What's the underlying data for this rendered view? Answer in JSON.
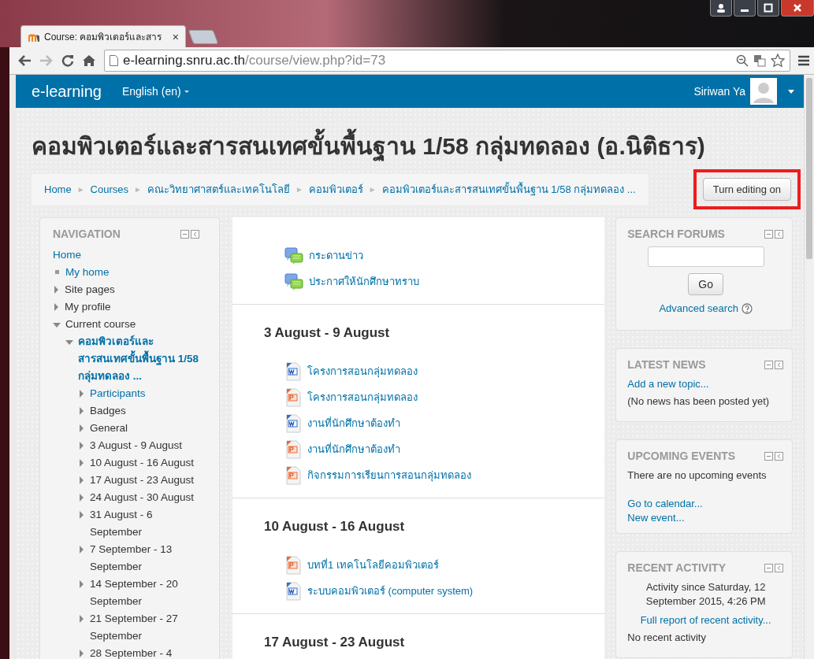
{
  "browser": {
    "tab": {
      "title": "Course: คอมพิวเตอร์และสาร",
      "close": "×"
    },
    "url": {
      "host": "e-learning.snru.ac.th",
      "path": "/course/view.php?id=73"
    }
  },
  "navbar": {
    "brand": "e-learning",
    "language": "English (en)",
    "user": "Siriwan Ya"
  },
  "page": {
    "title": "คอมพิวเตอร์และสารสนเทศขั้นพื้นฐาน 1/58 กลุ่มทดลอง (อ.นิติธาร)",
    "breadcrumb_separator": "►",
    "breadcrumb": [
      "Home",
      "Courses",
      "คณะวิทยาศาสตร์และเทคโนโลยี",
      "คอมพิวเตอร์",
      "คอมพิวเตอร์และสารสนเทศขั้นพื้นฐาน 1/58 กลุ่มทดลอง ..."
    ],
    "edit_button": {
      "label": "Turn editing on",
      "highlighted": true
    }
  },
  "navigation": {
    "title": "NAVIGATION",
    "items": [
      {
        "label": "Home",
        "kind": "plain",
        "link": true
      },
      {
        "label": "My home",
        "kind": "bullet",
        "link": true
      },
      {
        "label": "Site pages",
        "kind": "branch",
        "link": false,
        "expanded": false
      },
      {
        "label": "My profile",
        "kind": "branch",
        "link": false,
        "expanded": false
      },
      {
        "label": "Current course",
        "kind": "branch",
        "link": false,
        "expanded": true,
        "children": [
          {
            "label": "คอมพิวเตอร์และสารสนเทศขั้นพื้นฐาน 1/58 กลุ่มทดลอง ...",
            "kind": "branch",
            "link": true,
            "active": true,
            "expanded": true,
            "children": [
              {
                "label": "Participants",
                "kind": "branch",
                "link": true,
                "expanded": false
              },
              {
                "label": "Badges",
                "kind": "branch",
                "link": false,
                "expanded": false
              },
              {
                "label": "General",
                "kind": "branch",
                "link": false,
                "expanded": false
              },
              {
                "label": "3 August - 9 August",
                "kind": "branch",
                "link": false,
                "expanded": false
              },
              {
                "label": "10 August - 16 August",
                "kind": "branch",
                "link": false,
                "expanded": false
              },
              {
                "label": "17 August - 23 August",
                "kind": "branch",
                "link": false,
                "expanded": false
              },
              {
                "label": "24 August - 30 August",
                "kind": "branch",
                "link": false,
                "expanded": false
              },
              {
                "label": "31 August - 6 September",
                "kind": "branch",
                "link": false,
                "expanded": false
              },
              {
                "label": "7 September - 13 September",
                "kind": "branch",
                "link": false,
                "expanded": false
              },
              {
                "label": "14 September - 20 September",
                "kind": "branch",
                "link": false,
                "expanded": false
              },
              {
                "label": "21 September - 27 September",
                "kind": "branch",
                "link": false,
                "expanded": false
              },
              {
                "label": "28 September - 4",
                "kind": "branch",
                "link": false,
                "expanded": false
              }
            ]
          }
        ]
      }
    ]
  },
  "sections": [
    {
      "activities": [
        {
          "kind": "forum",
          "label": "กระดานข่าว"
        },
        {
          "kind": "forum",
          "label": "ประกาศให้นักศึกษาทราบ"
        }
      ]
    },
    {
      "title": "3 August - 9 August",
      "activities": [
        {
          "kind": "word",
          "label": "โครงการสอนกลุ่มทดลอง"
        },
        {
          "kind": "powerpoint",
          "label": "โครงการสอนกลุ่มทดลอง"
        },
        {
          "kind": "word",
          "label": "งานที่นักศึกษาต้องทำ"
        },
        {
          "kind": "powerpoint",
          "label": "งานที่นักศึกษาต้องทำ"
        },
        {
          "kind": "powerpoint",
          "label": "กิจกรรมการเรียนการสอนกลุ่มทดลอง"
        }
      ]
    },
    {
      "title": "10 August - 16 August",
      "activities": [
        {
          "kind": "powerpoint",
          "label": "บทที่1 เทคโนโลยีคอมพิวเตอร์"
        },
        {
          "kind": "word",
          "label": "ระบบคอมพิวเตอร์ (computer system)"
        }
      ]
    },
    {
      "title": "17 August - 23 August"
    }
  ],
  "blocks": [
    {
      "title": "SEARCH FORUMS",
      "content": [
        {
          "kind": "input"
        },
        {
          "kind": "button",
          "text": "Go"
        },
        {
          "kind": "help_link",
          "text": "Advanced search"
        }
      ]
    },
    {
      "title": "LATEST NEWS",
      "content": [
        {
          "kind": "link",
          "text": "Add a new topic..."
        },
        {
          "kind": "text",
          "text": "(No news has been posted yet)"
        }
      ]
    },
    {
      "title": "UPCOMING EVENTS",
      "content": [
        {
          "kind": "text",
          "text": "There are no upcoming events"
        },
        {
          "kind": "gap"
        },
        {
          "kind": "link",
          "text": "Go to calendar..."
        },
        {
          "kind": "link",
          "text": "New event..."
        }
      ]
    },
    {
      "title": "RECENT ACTIVITY",
      "content": [
        {
          "kind": "centered_text",
          "text": "Activity since Saturday, 12 September 2015, 4:26 PM"
        },
        {
          "kind": "centered_link",
          "text": "Full report of recent activity..."
        },
        {
          "kind": "text",
          "text": "No recent activity"
        }
      ]
    }
  ]
}
